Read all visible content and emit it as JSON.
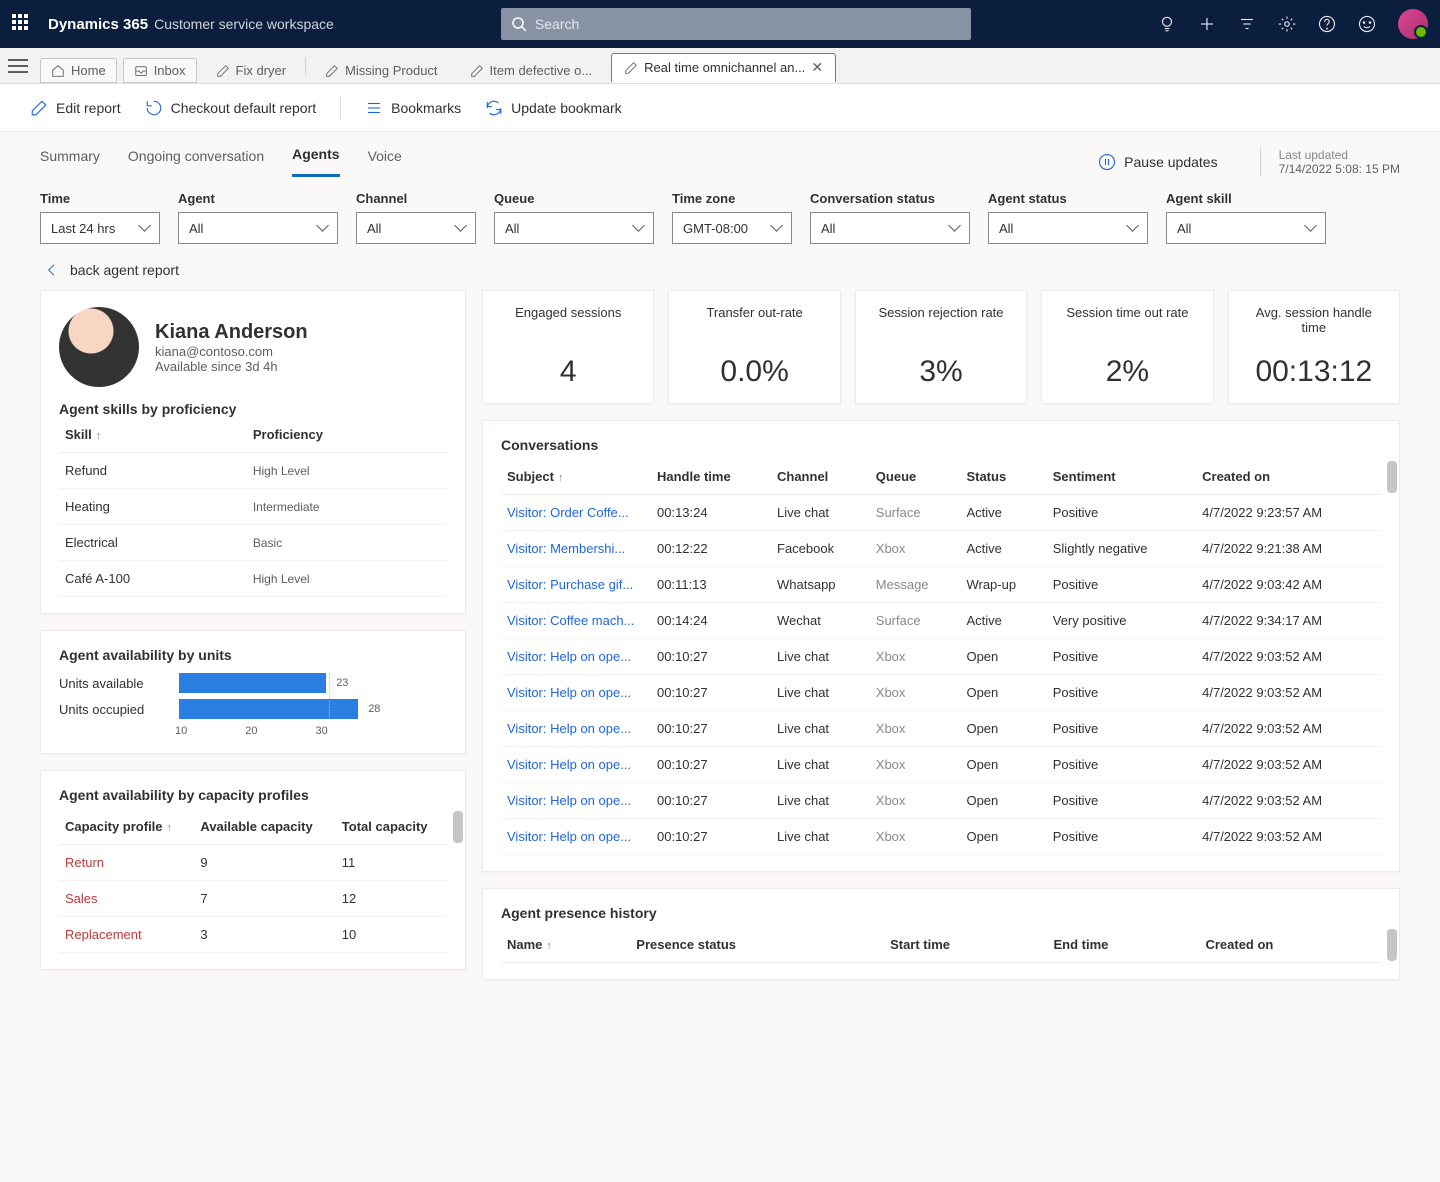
{
  "header": {
    "brand": "Dynamics 365",
    "brandSub": "Customer service workspace",
    "searchPlaceholder": "Search"
  },
  "tabs": {
    "home": "Home",
    "inbox": "Inbox",
    "items": [
      {
        "label": "Fix dryer"
      },
      {
        "label": "Missing Product"
      },
      {
        "label": "Item defective o..."
      },
      {
        "label": "Real time omnichannel an...",
        "active": true
      }
    ]
  },
  "commands": {
    "edit": "Edit report",
    "checkout": "Checkout default report",
    "bookmarks": "Bookmarks",
    "update": "Update bookmark"
  },
  "subnav": {
    "tabs": [
      "Summary",
      "Ongoing conversation",
      "Agents",
      "Voice"
    ],
    "activeIndex": 2,
    "pause": "Pause updates",
    "lastUpdatedLabel": "Last updated",
    "lastUpdatedValue": "7/14/2022 5:08: 15 PM"
  },
  "filters": {
    "time": {
      "label": "Time",
      "value": "Last 24 hrs"
    },
    "agent": {
      "label": "Agent",
      "value": "All"
    },
    "channel": {
      "label": "Channel",
      "value": "All"
    },
    "queue": {
      "label": "Queue",
      "value": "All"
    },
    "timezone": {
      "label": "Time zone",
      "value": "GMT-08:00"
    },
    "convstatus": {
      "label": "Conversation status",
      "value": "All"
    },
    "agentstatus": {
      "label": "Agent status",
      "value": "All"
    },
    "agentskill": {
      "label": "Agent skill",
      "value": "All"
    }
  },
  "backlink": "back agent report",
  "agent": {
    "name": "Kiana Anderson",
    "email": "kiana@contoso.com",
    "availability": "Available since 3d 4h"
  },
  "skills": {
    "title": "Agent skills by proficiency",
    "headers": {
      "skill": "Skill",
      "prof": "Proficiency"
    },
    "rows": [
      {
        "skill": "Refund",
        "prof": "High Level"
      },
      {
        "skill": "Heating",
        "prof": "Intermediate"
      },
      {
        "skill": "Electrical",
        "prof": "Basic"
      },
      {
        "skill": "Café A-100",
        "prof": "High Level"
      }
    ]
  },
  "availUnits": {
    "title": "Agent availability by units",
    "rows": [
      {
        "label": "Units available",
        "value": 23
      },
      {
        "label": "Units occupied",
        "value": 28
      }
    ],
    "axis": [
      "10",
      "20",
      "30"
    ]
  },
  "capacity": {
    "title": "Agent availability by capacity profiles",
    "headers": {
      "profile": "Capacity profile",
      "avail": "Available capacity",
      "total": "Total capacity"
    },
    "rows": [
      {
        "profile": "Return",
        "avail": "9",
        "total": "11"
      },
      {
        "profile": "Sales",
        "avail": "7",
        "total": "12"
      },
      {
        "profile": "Replacement",
        "avail": "3",
        "total": "10"
      }
    ]
  },
  "kpis": [
    {
      "label": "Engaged sessions",
      "value": "4"
    },
    {
      "label": "Transfer out-rate",
      "value": "0.0%"
    },
    {
      "label": "Session rejection rate",
      "value": "3%"
    },
    {
      "label": "Session time out rate",
      "value": "2%"
    },
    {
      "label": "Avg. session handle time",
      "value": "00:13:12"
    }
  ],
  "conversations": {
    "title": "Conversations",
    "headers": {
      "subject": "Subject",
      "handle": "Handle time",
      "channel": "Channel",
      "queue": "Queue",
      "status": "Status",
      "sentiment": "Sentiment",
      "created": "Created on"
    },
    "rows": [
      {
        "subject": "Visitor: Order Coffe...",
        "handle": "00:13:24",
        "channel": "Live chat",
        "queue": "Surface",
        "status": "Active",
        "sentiment": "Positive",
        "created": "4/7/2022 9:23:57 AM"
      },
      {
        "subject": "Visitor: Membershi...",
        "handle": "00:12:22",
        "channel": "Facebook",
        "queue": "Xbox",
        "status": "Active",
        "sentiment": "Slightly negative",
        "created": "4/7/2022 9:21:38 AM"
      },
      {
        "subject": "Visitor: Purchase gif...",
        "handle": "00:11:13",
        "channel": "Whatsapp",
        "queue": "Message",
        "status": "Wrap-up",
        "sentiment": "Positive",
        "created": "4/7/2022 9:03:42 AM"
      },
      {
        "subject": "Visitor: Coffee mach...",
        "handle": "00:14:24",
        "channel": "Wechat",
        "queue": "Surface",
        "status": "Active",
        "sentiment": "Very positive",
        "created": "4/7/2022 9:34:17 AM"
      },
      {
        "subject": "Visitor: Help on ope...",
        "handle": "00:10:27",
        "channel": "Live chat",
        "queue": "Xbox",
        "status": "Open",
        "sentiment": "Positive",
        "created": "4/7/2022 9:03:52 AM"
      },
      {
        "subject": "Visitor: Help on ope...",
        "handle": "00:10:27",
        "channel": "Live chat",
        "queue": "Xbox",
        "status": "Open",
        "sentiment": "Positive",
        "created": "4/7/2022 9:03:52 AM"
      },
      {
        "subject": "Visitor: Help on ope...",
        "handle": "00:10:27",
        "channel": "Live chat",
        "queue": "Xbox",
        "status": "Open",
        "sentiment": "Positive",
        "created": "4/7/2022 9:03:52 AM"
      },
      {
        "subject": "Visitor: Help on ope...",
        "handle": "00:10:27",
        "channel": "Live chat",
        "queue": "Xbox",
        "status": "Open",
        "sentiment": "Positive",
        "created": "4/7/2022 9:03:52 AM"
      },
      {
        "subject": "Visitor: Help on ope...",
        "handle": "00:10:27",
        "channel": "Live chat",
        "queue": "Xbox",
        "status": "Open",
        "sentiment": "Positive",
        "created": "4/7/2022 9:03:52 AM"
      },
      {
        "subject": "Visitor: Help on ope...",
        "handle": "00:10:27",
        "channel": "Live chat",
        "queue": "Xbox",
        "status": "Open",
        "sentiment": "Positive",
        "created": "4/7/2022 9:03:52 AM"
      }
    ]
  },
  "presence": {
    "title": "Agent presence history",
    "headers": {
      "name": "Name",
      "status": "Presence status",
      "start": "Start time",
      "end": "End time",
      "created": "Created on"
    }
  },
  "chart_data": {
    "type": "bar",
    "orientation": "horizontal",
    "title": "Agent availability by units",
    "categories": [
      "Units available",
      "Units occupied"
    ],
    "values": [
      23,
      28
    ],
    "xlim": [
      0,
      30
    ],
    "xticks": [
      10,
      20,
      30
    ]
  }
}
